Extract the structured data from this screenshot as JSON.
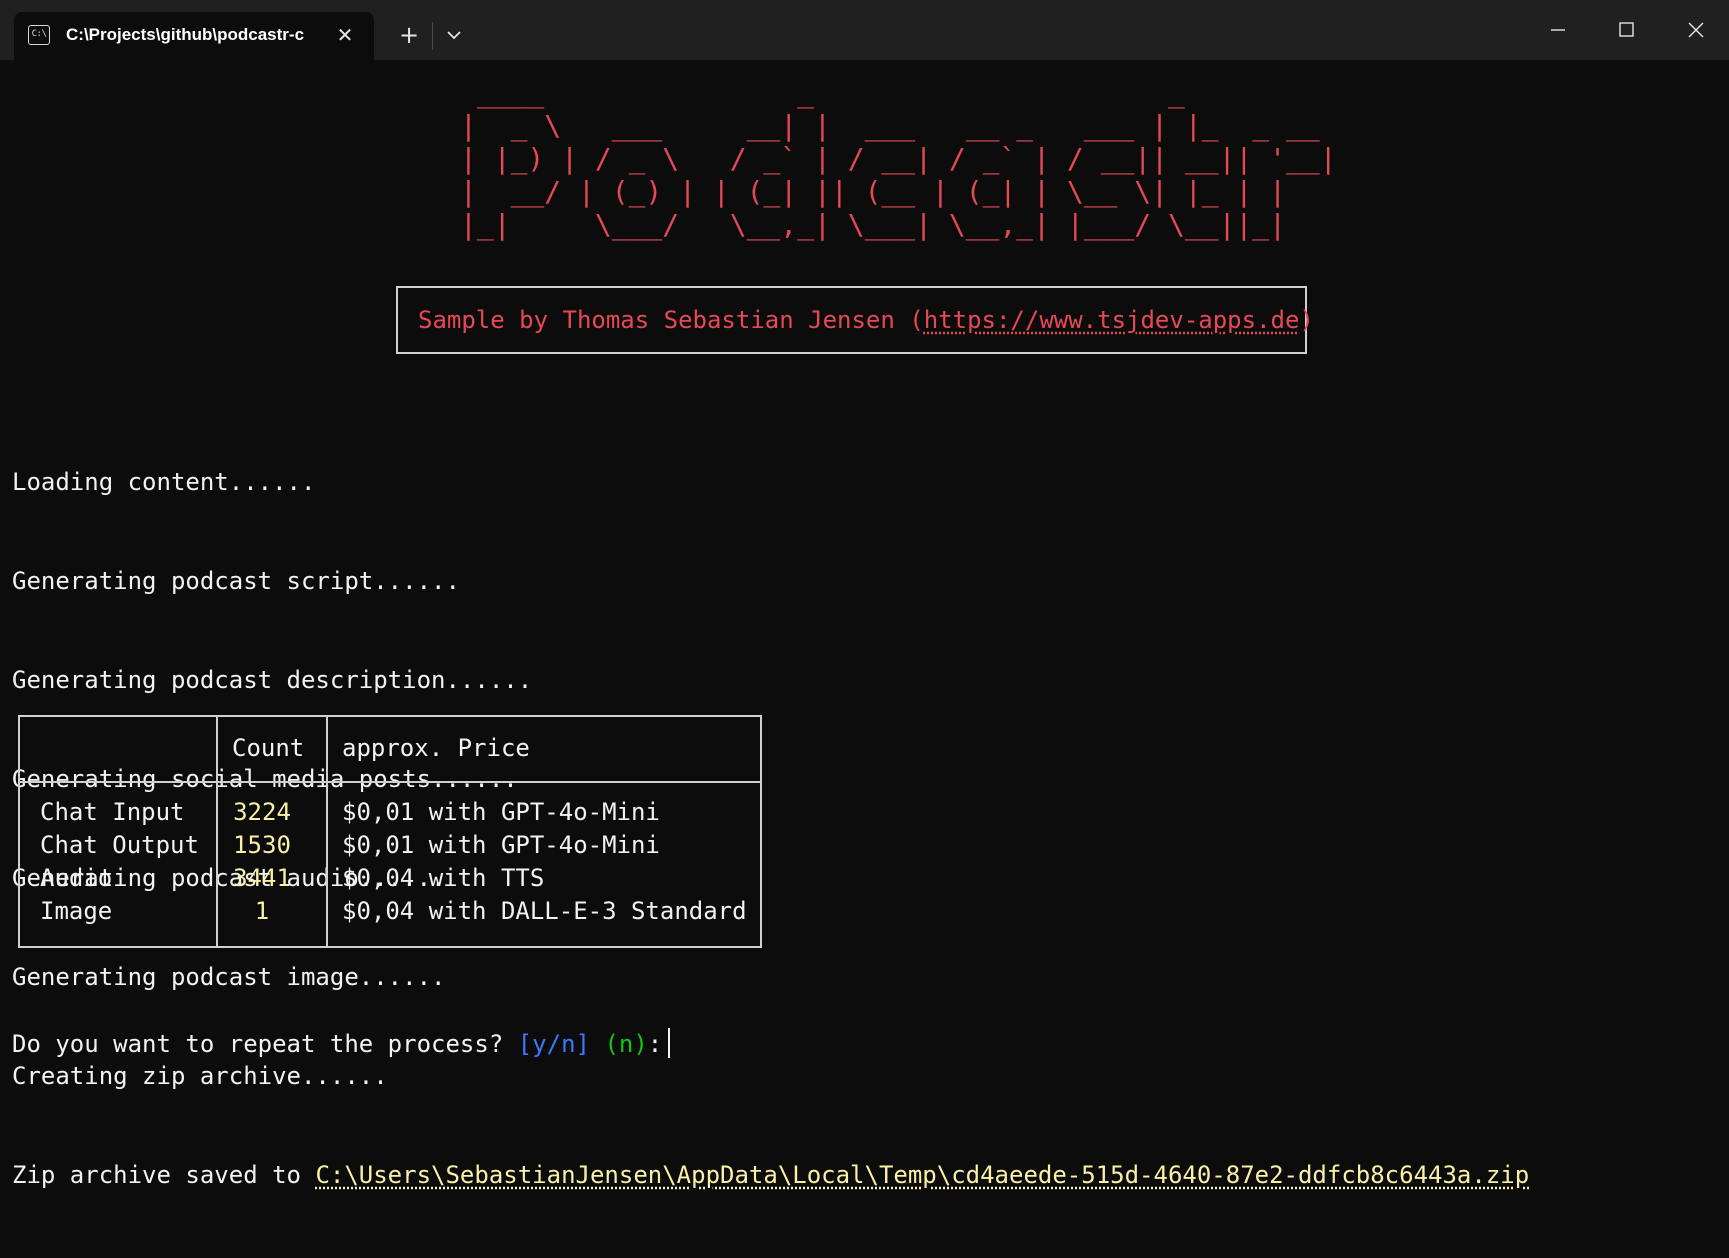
{
  "window": {
    "tab_icon": "cmd-icon",
    "tab_icon_text": "C:\\",
    "tab_title": "C:\\Projects\\github\\podcastr-c",
    "new_tab_symbol": "+",
    "close_tab_symbol": "✕"
  },
  "banner": {
    "ascii_lines": [
      " ____               _                     _",
      "|  _ \\   ___     __| |  ___   __ _   ___ | |_  _ __",
      "| |_) | / _ \\   / _` | / __| / _` | / __|| __|| '__|",
      "|  __/ | (_) | | (_| || (__ | (_| | \\__ \\| |_ | |",
      "|_|     \\___/   \\__,_| \\___| \\__,_| |___/ \\__||_|"
    ],
    "sample_prefix": "Sample by Thomas Sebastian Jensen (",
    "sample_link": "https://www.tsjdev-apps.de",
    "sample_suffix": ")"
  },
  "log": {
    "lines": [
      "Loading content......",
      "Generating podcast script......",
      "Generating podcast description......",
      "Generating social media posts......",
      "Generating podcast audio......",
      "Generating podcast image......",
      "Creating zip archive......"
    ],
    "zip_prefix": "Zip archive saved to ",
    "zip_path": "C:\\Users\\SebastianJensen\\AppData\\Local\\Temp\\cd4aeede-515d-4640-87e2-ddfcb8c6443a.zip"
  },
  "table": {
    "headers": [
      "",
      "Count",
      "approx. Price"
    ],
    "rows": [
      {
        "label": "Chat Input",
        "count": "3224",
        "price": "$0,01 with GPT-4o-Mini"
      },
      {
        "label": "Chat Output",
        "count": "1530",
        "price": "$0,01 with GPT-4o-Mini"
      },
      {
        "label": "Audio",
        "count": "3441",
        "price": "$0,04 with TTS"
      },
      {
        "label": "Image",
        "count": "1",
        "price": "$0,04 with DALL-E-3 Standard"
      }
    ]
  },
  "prompt": {
    "question": "Do you want to repeat the process? ",
    "options": "[y/n]",
    "default": "(n)",
    "colon": ":"
  },
  "colors": {
    "background": "#0c0c0c",
    "banner": "#e74856",
    "highlight": "#f9f1a5",
    "options": "#3b78ff",
    "default": "#16c60c"
  }
}
